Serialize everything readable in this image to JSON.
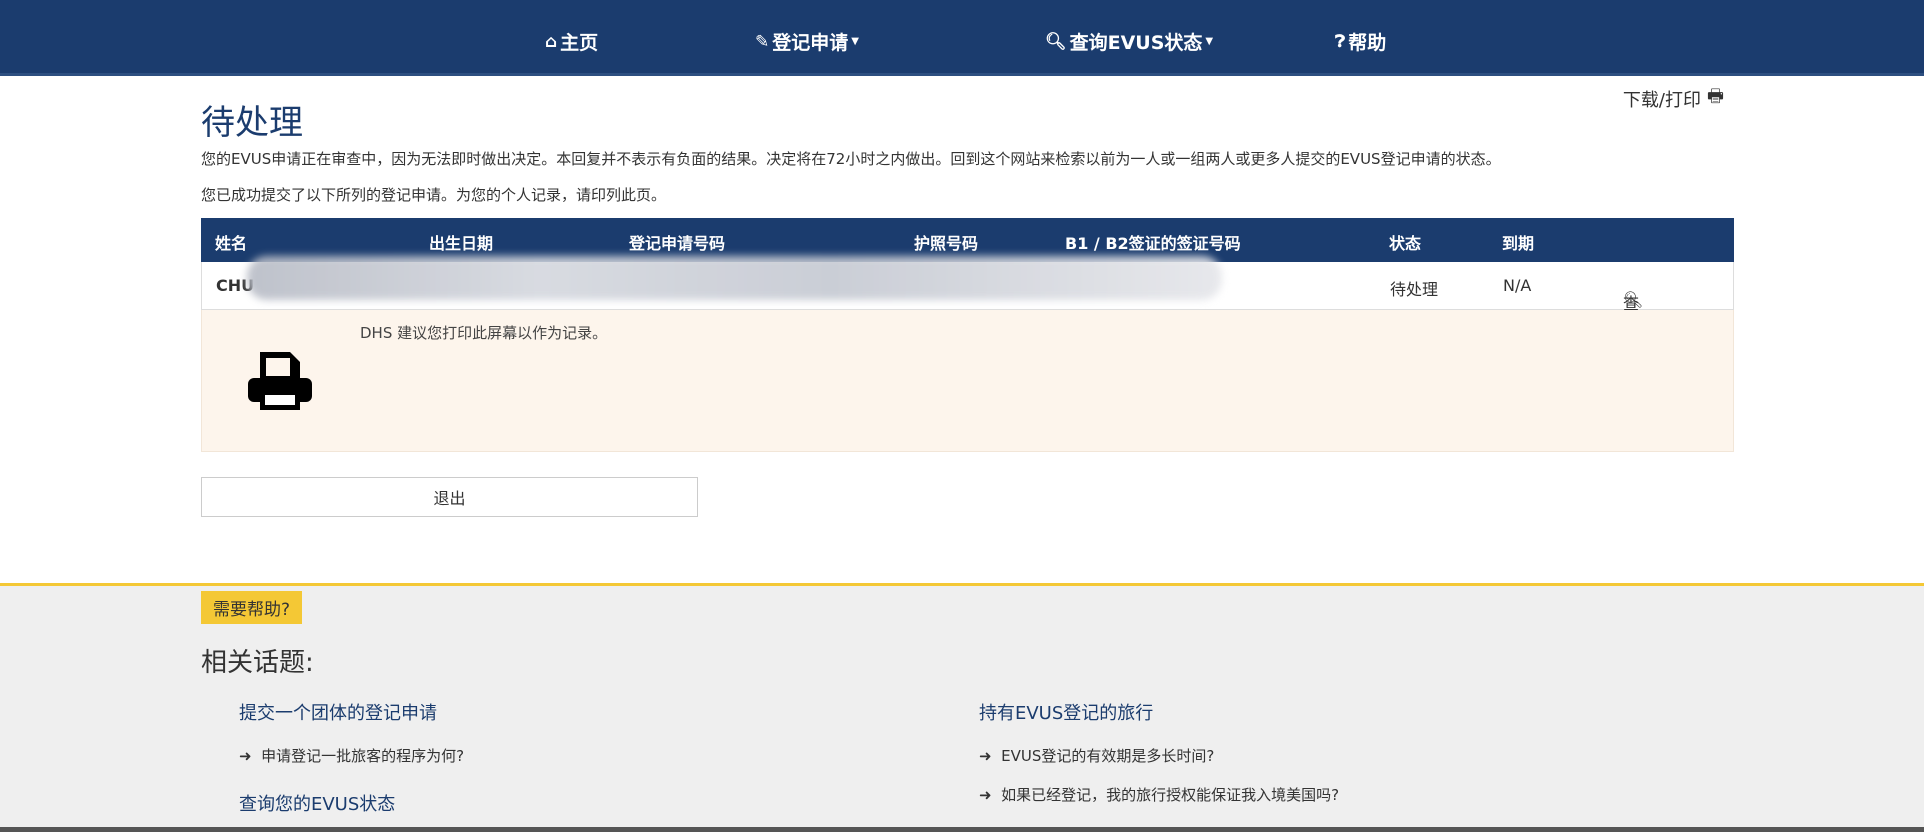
{
  "nav": {
    "items": [
      {
        "label": "主页",
        "icon": "home-icon",
        "glyph": "⌂",
        "caret": false
      },
      {
        "label": "登记申请",
        "icon": "pencil-icon",
        "glyph": "✎",
        "caret": true
      },
      {
        "label": "查询EVUS状态",
        "icon": "search-icon",
        "glyph": "🔍︎",
        "caret": true
      },
      {
        "label": "帮助",
        "icon": "question-circle-icon",
        "glyph": "❓︎",
        "caret": false
      }
    ]
  },
  "page": {
    "title": "待处理",
    "download_print": "下载/打印",
    "para1": "您的EVUS申请正在审查中，因为无法即时做出决定。本回复并不表示有负面的结果。决定将在72小时之内做出。回到这个网站来检索以前为一人或一组两人或更多人提交的EVUS登记申请的状态。",
    "para2": "您已成功提交了以下所列的登记申请。为您的个人记录，请印列此页。"
  },
  "table": {
    "headers": [
      "姓名",
      "出生日期",
      "登记申请号码",
      "护照号码",
      "B1 / B2签证的签证号码",
      "状态",
      "到期"
    ],
    "rows": [
      {
        "name": "CHU",
        "status": "待处理",
        "expiry": "N/A",
        "view": "查看"
      }
    ]
  },
  "notice": {
    "text": "DHS 建议您打印此屏幕以作为记录。"
  },
  "exit_button": "退出",
  "footer": {
    "badge": "需要帮助?",
    "title": "相关话题:",
    "col1": {
      "heading1": "提交一个团体的登记申请",
      "link1": "申请登记一批旅客的程序为何?",
      "heading2": "查询您的EVUS状态"
    },
    "col2": {
      "heading1": "持有EVUS登记的旅行",
      "link1": "EVUS登记的有效期是多长时间?",
      "link2": "如果已经登记，我的旅行授权能保证我入境美国吗?"
    }
  },
  "colors": {
    "navy": "#1b3c6e",
    "yellow": "#f4c835",
    "notice_bg": "#fdf5ec"
  }
}
